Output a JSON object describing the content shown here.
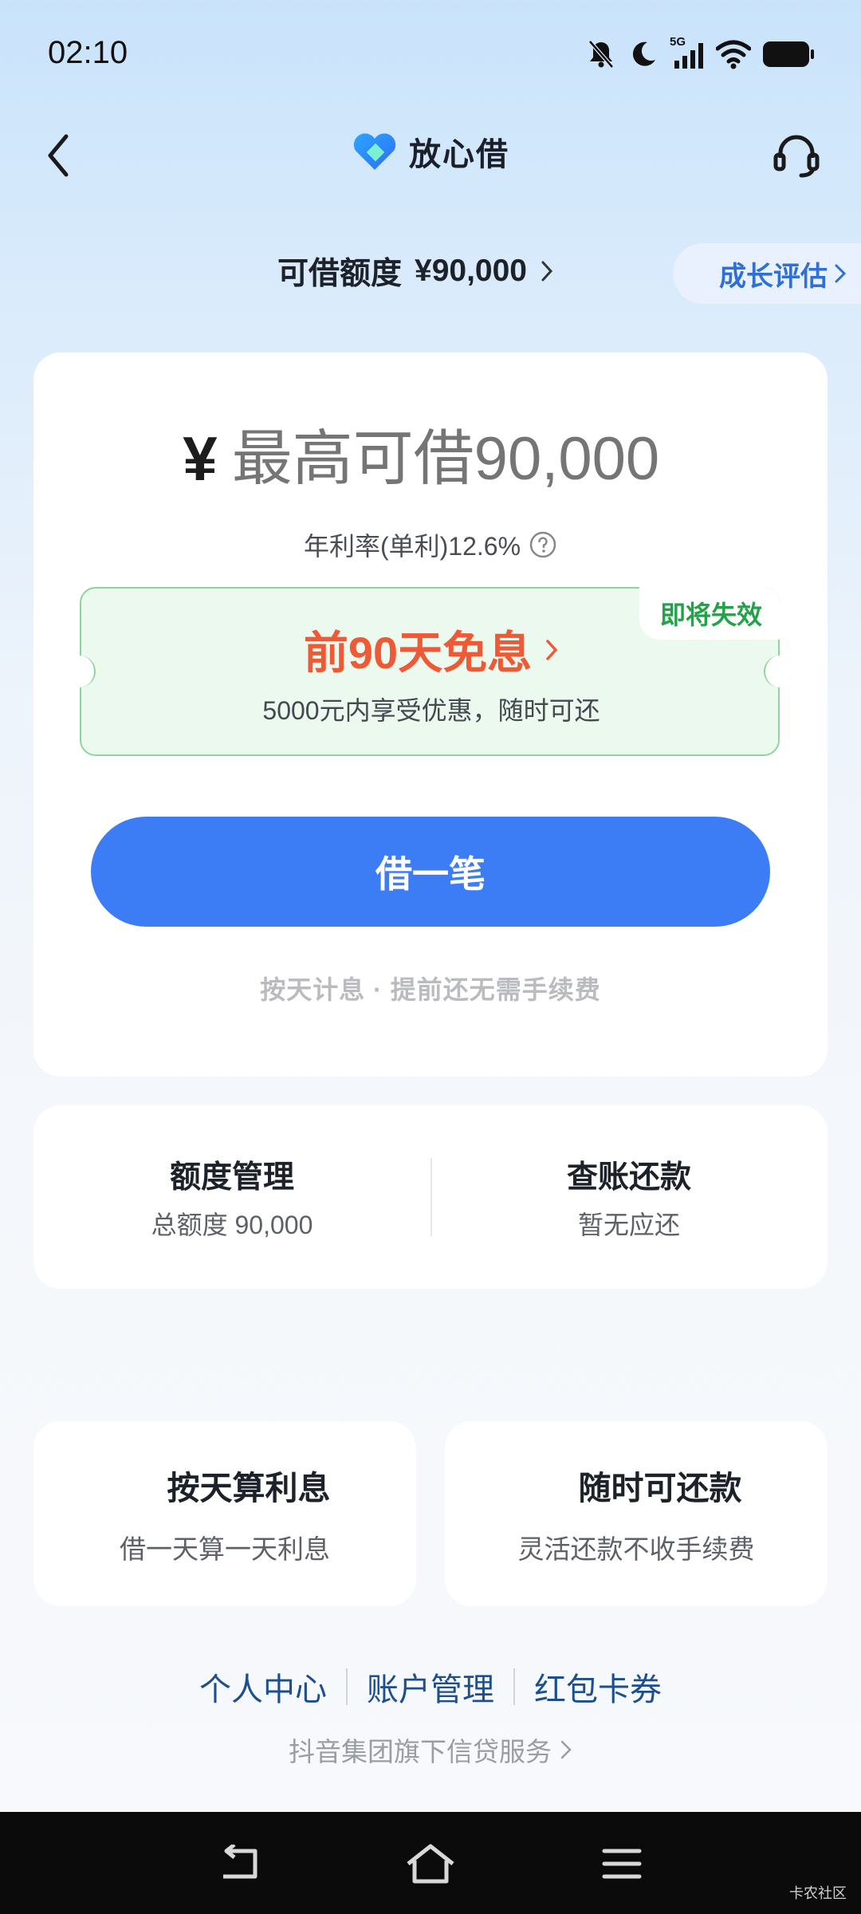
{
  "status_bar": {
    "time": "02:10",
    "network": "5G"
  },
  "header": {
    "app_name": "放心借",
    "back_icon": "chevron-left-icon",
    "service_icon": "headset-icon"
  },
  "limit": {
    "label": "可借额度",
    "amount": "¥90,000",
    "growth_label": "成长评估"
  },
  "borrow_card": {
    "currency": "¥",
    "amount_placeholder": "最高可借90,000",
    "rate_text": "年利率(单利)12.6%",
    "promo": {
      "badge": "即将失效",
      "title": "前90天免息",
      "subtitle": "5000元内享受优惠，随时可还"
    },
    "borrow_button": "借一笔",
    "note": "按天计息 · 提前还无需手续费"
  },
  "quick": [
    {
      "title": "额度管理",
      "sub": "总额度 90,000"
    },
    {
      "title": "查账还款",
      "sub": "暂无应还"
    }
  ],
  "features": [
    {
      "title": "按天算利息",
      "sub": "借一天算一天利息"
    },
    {
      "title": "随时可还款",
      "sub": "灵活还款不收手续费"
    }
  ],
  "bottom_links": [
    "个人中心",
    "账户管理",
    "红包卡券"
  ],
  "group_service": "抖音集团旗下信贷服务",
  "watermark": "卡农社区",
  "colors": {
    "primary": "#3c7cf5",
    "promo": "#ef5a36",
    "badge": "#22a34a",
    "link": "#1d4f8f"
  }
}
